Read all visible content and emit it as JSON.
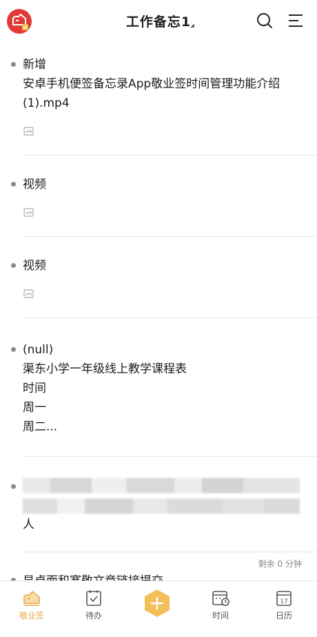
{
  "header": {
    "title": "工作备忘1",
    "logo_icon": "app-logo-icon",
    "search_icon": "search-icon",
    "menu_icon": "menu-icon"
  },
  "notes": [
    {
      "lines": [
        "新增",
        "安卓手机便签备忘录App敬业签时间管理功能介绍",
        "(1).mp4"
      ],
      "has_attachment": true
    },
    {
      "lines": [
        "视频"
      ],
      "has_attachment": true
    },
    {
      "lines": [
        "视频"
      ],
      "has_attachment": true
    },
    {
      "lines": [
        "(null)",
        "渠东小学一年级线上教学课程表",
        "时间",
        "周一",
        "周二..."
      ],
      "has_attachment": false
    },
    {
      "lines": [
        "人"
      ],
      "has_attachment": false,
      "obscured": true
    }
  ],
  "remaining_label": "剩余 0 分钟",
  "partial_next": "显卓面和塞敬文章链接提交",
  "tabbar": {
    "items": [
      {
        "label": "敬业签",
        "icon": "cloud-logo-icon",
        "active": true
      },
      {
        "label": "待办",
        "icon": "calendar-check-icon",
        "active": false
      },
      {
        "label": "",
        "icon": "plus-icon",
        "active": false
      },
      {
        "label": "时间",
        "icon": "calendar-clock-icon",
        "active": false
      },
      {
        "label": "日历",
        "icon": "calendar-17-icon",
        "active": false
      }
    ]
  },
  "colors": {
    "accent": "#e9a94a",
    "logo_red": "#e23a36",
    "fab": "#f3bf5b"
  }
}
